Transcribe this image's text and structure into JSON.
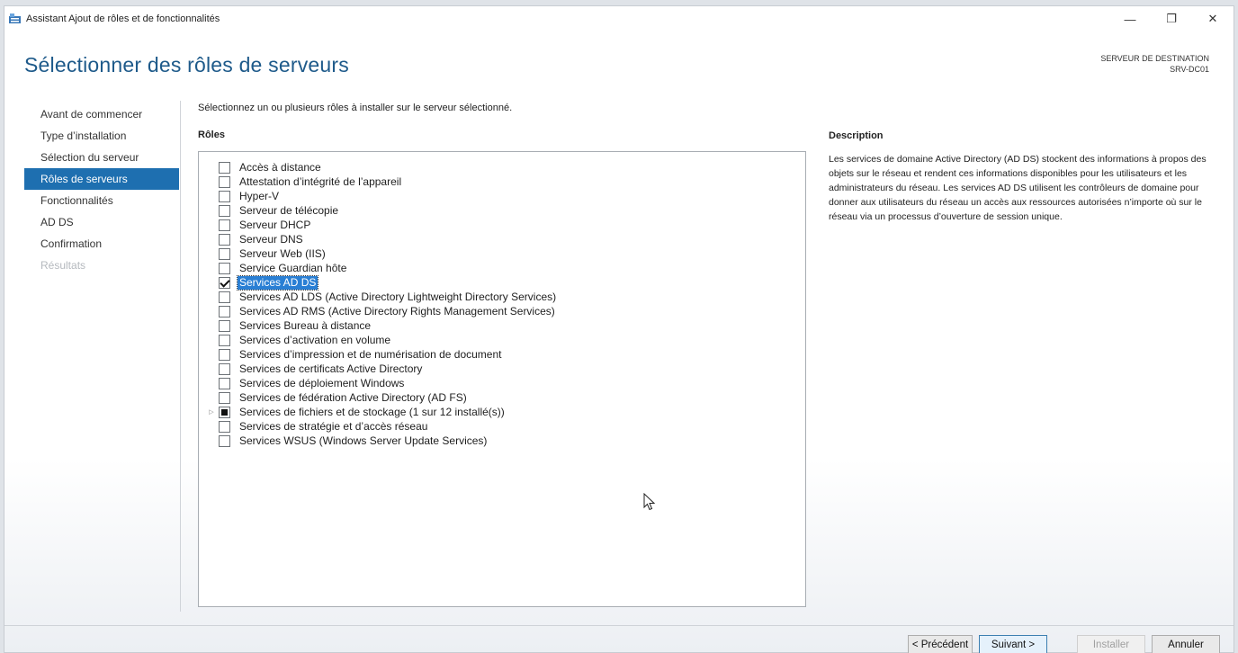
{
  "window": {
    "title": "Assistant Ajout de rôles et de fonctionnalités",
    "controls": {
      "minimize": "—",
      "restore": "❐",
      "close": "✕"
    }
  },
  "header": {
    "title": "Sélectionner des rôles de serveurs",
    "destination_label": "SERVEUR DE DESTINATION",
    "destination_server": "SRV-DC01"
  },
  "nav": {
    "items": [
      {
        "label": "Avant de commencer",
        "state": "normal"
      },
      {
        "label": "Type d’installation",
        "state": "normal"
      },
      {
        "label": "Sélection du serveur",
        "state": "normal"
      },
      {
        "label": "Rôles de serveurs",
        "state": "active"
      },
      {
        "label": "Fonctionnalités",
        "state": "normal"
      },
      {
        "label": "AD DS",
        "state": "normal"
      },
      {
        "label": "Confirmation",
        "state": "normal"
      },
      {
        "label": "Résultats",
        "state": "disabled"
      }
    ]
  },
  "main": {
    "instruction": "Sélectionnez un ou plusieurs rôles à installer sur le serveur sélectionné.",
    "roles_label": "Rôles",
    "roles": [
      {
        "label": "Accès à distance",
        "state": "unchecked"
      },
      {
        "label": "Attestation d’intégrité de l’appareil",
        "state": "unchecked"
      },
      {
        "label": "Hyper-V",
        "state": "unchecked"
      },
      {
        "label": "Serveur de télécopie",
        "state": "unchecked"
      },
      {
        "label": "Serveur DHCP",
        "state": "unchecked"
      },
      {
        "label": "Serveur DNS",
        "state": "unchecked"
      },
      {
        "label": "Serveur Web (IIS)",
        "state": "unchecked"
      },
      {
        "label": "Service Guardian hôte",
        "state": "unchecked"
      },
      {
        "label": "Services AD DS",
        "state": "checked",
        "selected": true
      },
      {
        "label": "Services AD LDS (Active Directory Lightweight Directory Services)",
        "state": "unchecked"
      },
      {
        "label": "Services AD RMS (Active Directory Rights Management Services)",
        "state": "unchecked"
      },
      {
        "label": "Services Bureau à distance",
        "state": "unchecked"
      },
      {
        "label": "Services d’activation en volume",
        "state": "unchecked"
      },
      {
        "label": "Services d’impression et de numérisation de document",
        "state": "unchecked"
      },
      {
        "label": "Services de certificats Active Directory",
        "state": "unchecked"
      },
      {
        "label": "Services de déploiement Windows",
        "state": "unchecked"
      },
      {
        "label": "Services de fédération Active Directory (AD FS)",
        "state": "unchecked"
      },
      {
        "label": "Services de fichiers et de stockage (1 sur 12 installé(s))",
        "state": "partial",
        "expandable": true
      },
      {
        "label": "Services de stratégie et d’accès réseau",
        "state": "unchecked"
      },
      {
        "label": "Services WSUS (Windows Server Update Services)",
        "state": "unchecked"
      }
    ],
    "description_title": "Description",
    "description_text": "Les services de domaine Active Directory (AD DS) stockent des informations à propos des objets sur le réseau et rendent ces informations disponibles pour les utilisateurs et les administrateurs du réseau. Les services AD DS utilisent les contrôleurs de domaine pour donner aux utilisateurs du réseau un accès aux ressources autorisées n’importe où sur le réseau via un processus d’ouverture de session unique."
  },
  "footer": {
    "previous": "< Précédent",
    "next": "Suivant >",
    "install": "Installer",
    "cancel": "Annuler"
  },
  "colors": {
    "accent": "#1e6fb0",
    "title_blue": "#1e5a8a",
    "selection": "#2a7fd4"
  },
  "icons": {
    "app": "server-manager-icon",
    "cursor": "mouse-pointer-icon",
    "expander": "triangle-right-icon"
  }
}
